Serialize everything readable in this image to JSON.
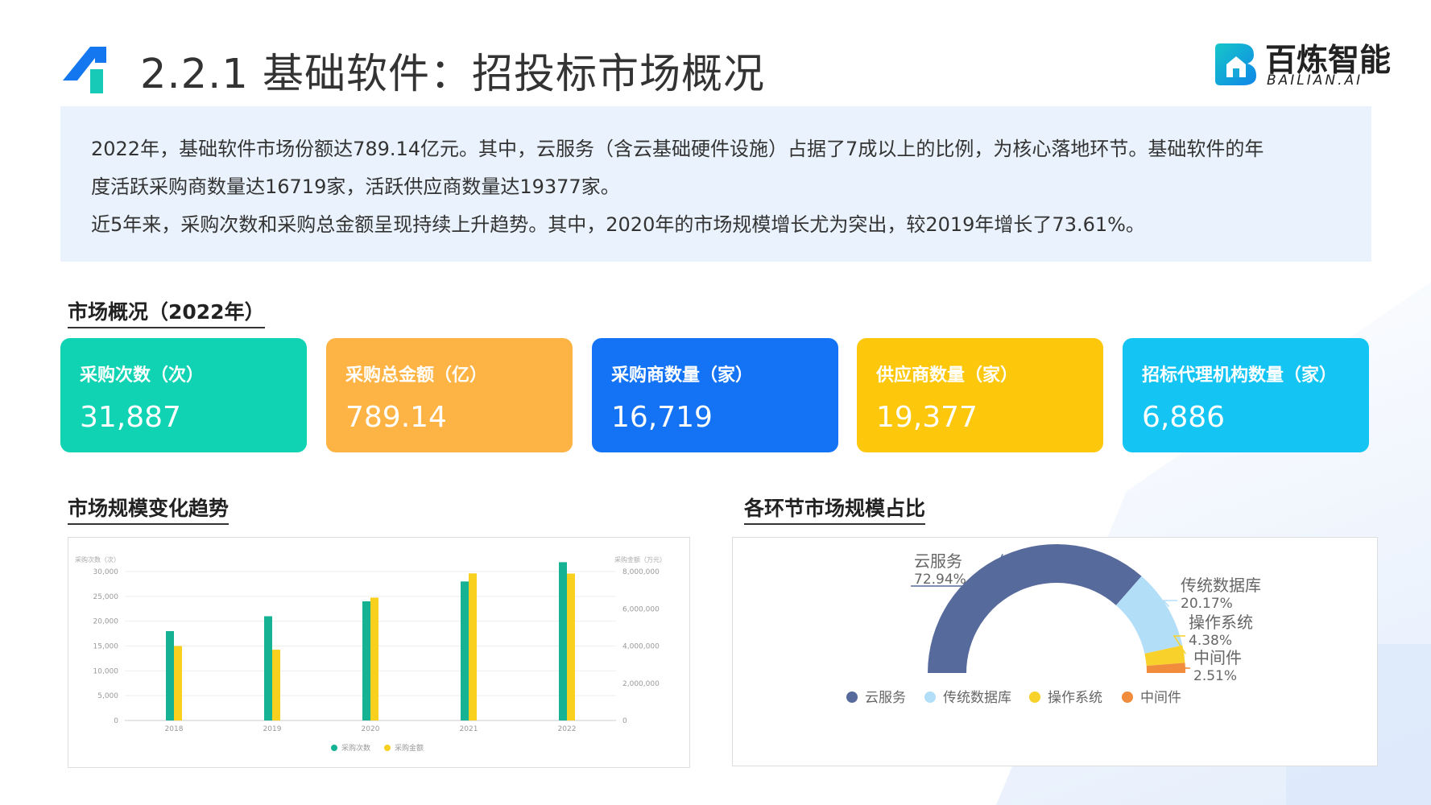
{
  "header": {
    "title": "2.2.1 基础软件：招投标市场概况",
    "brand_name": "百炼智能",
    "brand_en": "BAILIAN.AI"
  },
  "intro": {
    "line1": "2022年，基础软件市场份额达789.14亿元。其中，云服务（含云基础硬件设施）占据了7成以上的比例，为核心落地环节。基础软件的年",
    "line2": "度活跃采购商数量达16719家，活跃供应商数量达19377家。",
    "line3": "近5年来，采购次数和采购总金额呈现持续上升趋势。其中，2020年的市场规模增长尤为突出，较2019年增长了73.61%。"
  },
  "overview": {
    "heading": "市场概况（2022年）",
    "cards": [
      {
        "label": "采购次数（次）",
        "value": "31,887",
        "color": "#0fd3b2"
      },
      {
        "label": "采购总金额（亿）",
        "value": "789.14",
        "color": "#fdb445"
      },
      {
        "label": "采购商数量（家）",
        "value": "16,719",
        "color": "#1473f5"
      },
      {
        "label": "供应商数量（家）",
        "value": "19,377",
        "color": "#fdc80c"
      },
      {
        "label": "招标代理机构数量（家）",
        "value": "6,886",
        "color": "#14c5f3"
      }
    ]
  },
  "trend": {
    "heading": "市场规模变化趋势"
  },
  "share": {
    "heading": "各环节市场规模占比"
  },
  "chart_data": [
    {
      "type": "bar",
      "categories": [
        "2018",
        "2019",
        "2020",
        "2021",
        "2022"
      ],
      "series": [
        {
          "name": "采购次数",
          "axis": "left",
          "color": "#15b394",
          "values": [
            18000,
            21000,
            24000,
            28000,
            31887
          ]
        },
        {
          "name": "采购金额",
          "axis": "right",
          "color": "#f8d01d",
          "values": [
            4000000,
            3800000,
            6600000,
            7900000,
            7891400
          ]
        }
      ],
      "ylabel": "采购次数（次）",
      "y2label": "采购金额（万元）",
      "ylim": [
        0,
        30000
      ],
      "y2lim": [
        0,
        8000000
      ],
      "yticks": [
        "0",
        "5,000",
        "10,000",
        "15,000",
        "20,000",
        "25,000",
        "30,000"
      ],
      "y2ticks": [
        "0",
        "2,000,000",
        "4,000,000",
        "6,000,000",
        "8,000,000"
      ],
      "legend": "bottom-center"
    },
    {
      "type": "pie",
      "style": "half-donut",
      "slices": [
        {
          "name": "云服务",
          "value": 72.94,
          "label": "72.94%",
          "color": "#566b9c"
        },
        {
          "name": "传统数据库",
          "value": 20.17,
          "label": "20.17%",
          "color": "#b3def8"
        },
        {
          "name": "操作系统",
          "value": 4.38,
          "label": "4.38%",
          "color": "#f9d12b"
        },
        {
          "name": "中间件",
          "value": 2.51,
          "label": "2.51%",
          "color": "#f08c3c"
        }
      ],
      "legend": "bottom-center"
    }
  ]
}
